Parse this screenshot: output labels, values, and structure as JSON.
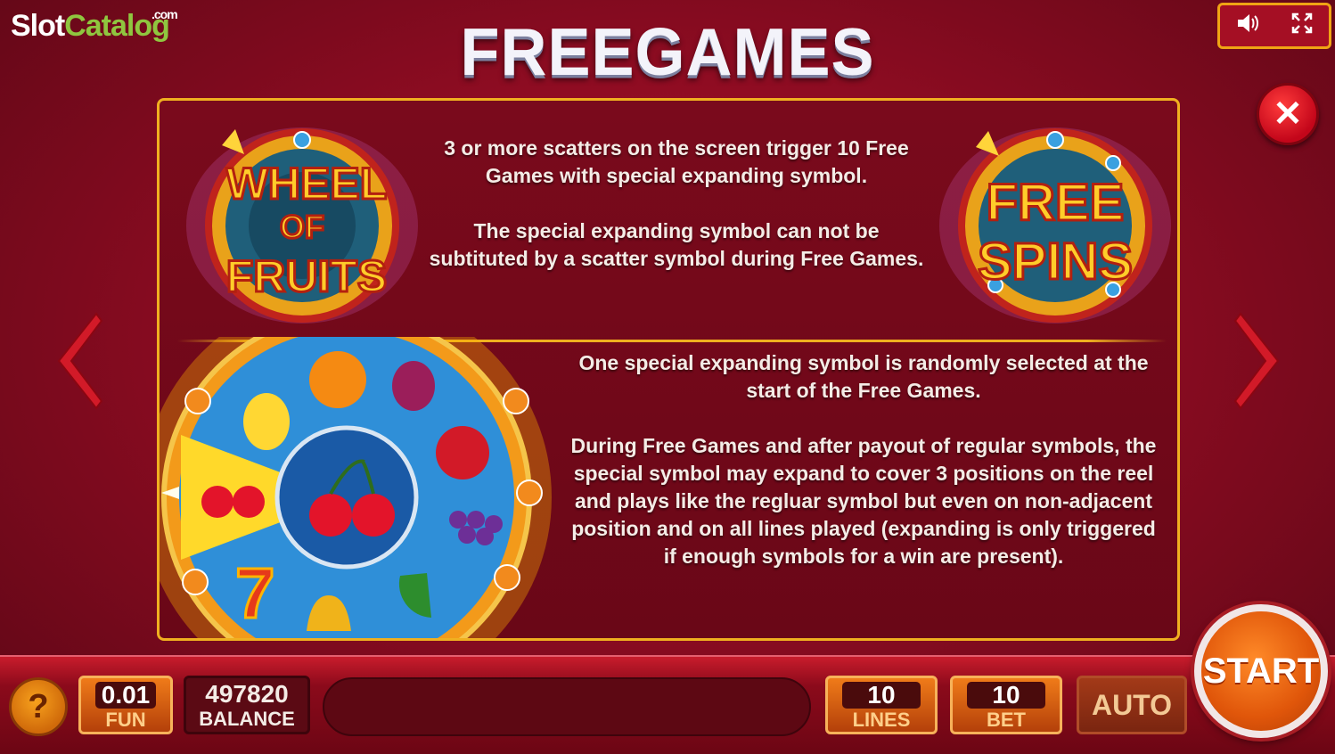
{
  "watermark": {
    "part1": "Slot",
    "part2": "Catalog",
    "suffix": ".com"
  },
  "title": "FREEGAMES",
  "top_controls": {
    "sound_icon": "speaker-icon",
    "fullscreen_icon": "fullscreen-icon"
  },
  "logos": {
    "left": {
      "line1": "WHEEL",
      "line2": "OF",
      "line3": "FRUITS"
    },
    "right": {
      "line1": "FREE",
      "line2": "SPINS"
    }
  },
  "info": {
    "top_paragraph_1": "3 or more scatters on the screen trigger 10 Free Games with special expanding symbol.",
    "top_paragraph_2": "The special expanding symbol can not be subtituted by a scatter symbol during Free Games.",
    "bottom_paragraph_1": "One special expanding symbol is randomly selected at the start of the Free Games.",
    "bottom_paragraph_2": "During Free Games and after payout of regular symbols, the special symbol may expand to cover 3 positions on the reel and plays like the regluar symbol but even on non-adjacent position and on all lines played (expanding is only triggered if enough symbols for a win are present)."
  },
  "bottom_bar": {
    "help_label": "?",
    "fun": {
      "value": "0.01",
      "label": "FUN"
    },
    "balance": {
      "value": "497820",
      "label": "BALANCE"
    },
    "lines": {
      "value": "10",
      "label": "LINES"
    },
    "bet": {
      "value": "10",
      "label": "BET"
    },
    "auto_label": "AUTO",
    "start_label": "START"
  },
  "colors": {
    "accent_gold": "#f0b020",
    "background_red": "#8e0c22",
    "start_orange": "#e0560a"
  }
}
